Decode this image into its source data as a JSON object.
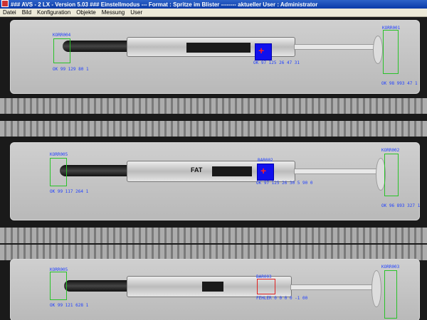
{
  "window": {
    "title": "### AVS - 2 LX - Version 5.03 ### Einstellmodus --- Format : Spritze im Blister -------- aktueller User : Administrator"
  },
  "menu": [
    "Datei",
    "Bild",
    "Konfiguration",
    "Objekte",
    "Messung",
    "User"
  ],
  "viewer": {
    "syringes": [
      {
        "print": "",
        "left_tag": "KORR004",
        "left_value": "OK 99 129 80 1",
        "mid_value": "OK 97 125 26 47 31",
        "right_tag": "KORR001",
        "right_value": "OK 98 993 47 1"
      },
      {
        "print": "FAT",
        "left_tag": "KORR005",
        "left_value": "OK 99 117 264 1",
        "mid_tag": "BAR002",
        "mid_value": "OK 97 125 26 30 5 90 0",
        "right_tag": "KORR002",
        "right_value": "OK 96 893 327 1"
      },
      {
        "print": "",
        "left_tag": "KORR005",
        "left_value": "OK 99 121 628 1",
        "mid_tag": "BAR003",
        "mid_value": "FEHLER 0 0 0 0 -1 00",
        "right_tag": "KORR003"
      }
    ]
  },
  "colors": {
    "ok_box": "#29c229",
    "error_box": "#e02020",
    "mark_fill": "#1010ee",
    "tag_text": "#2040ff"
  },
  "icons": [
    "app-icon",
    "crosshair-icon"
  ]
}
